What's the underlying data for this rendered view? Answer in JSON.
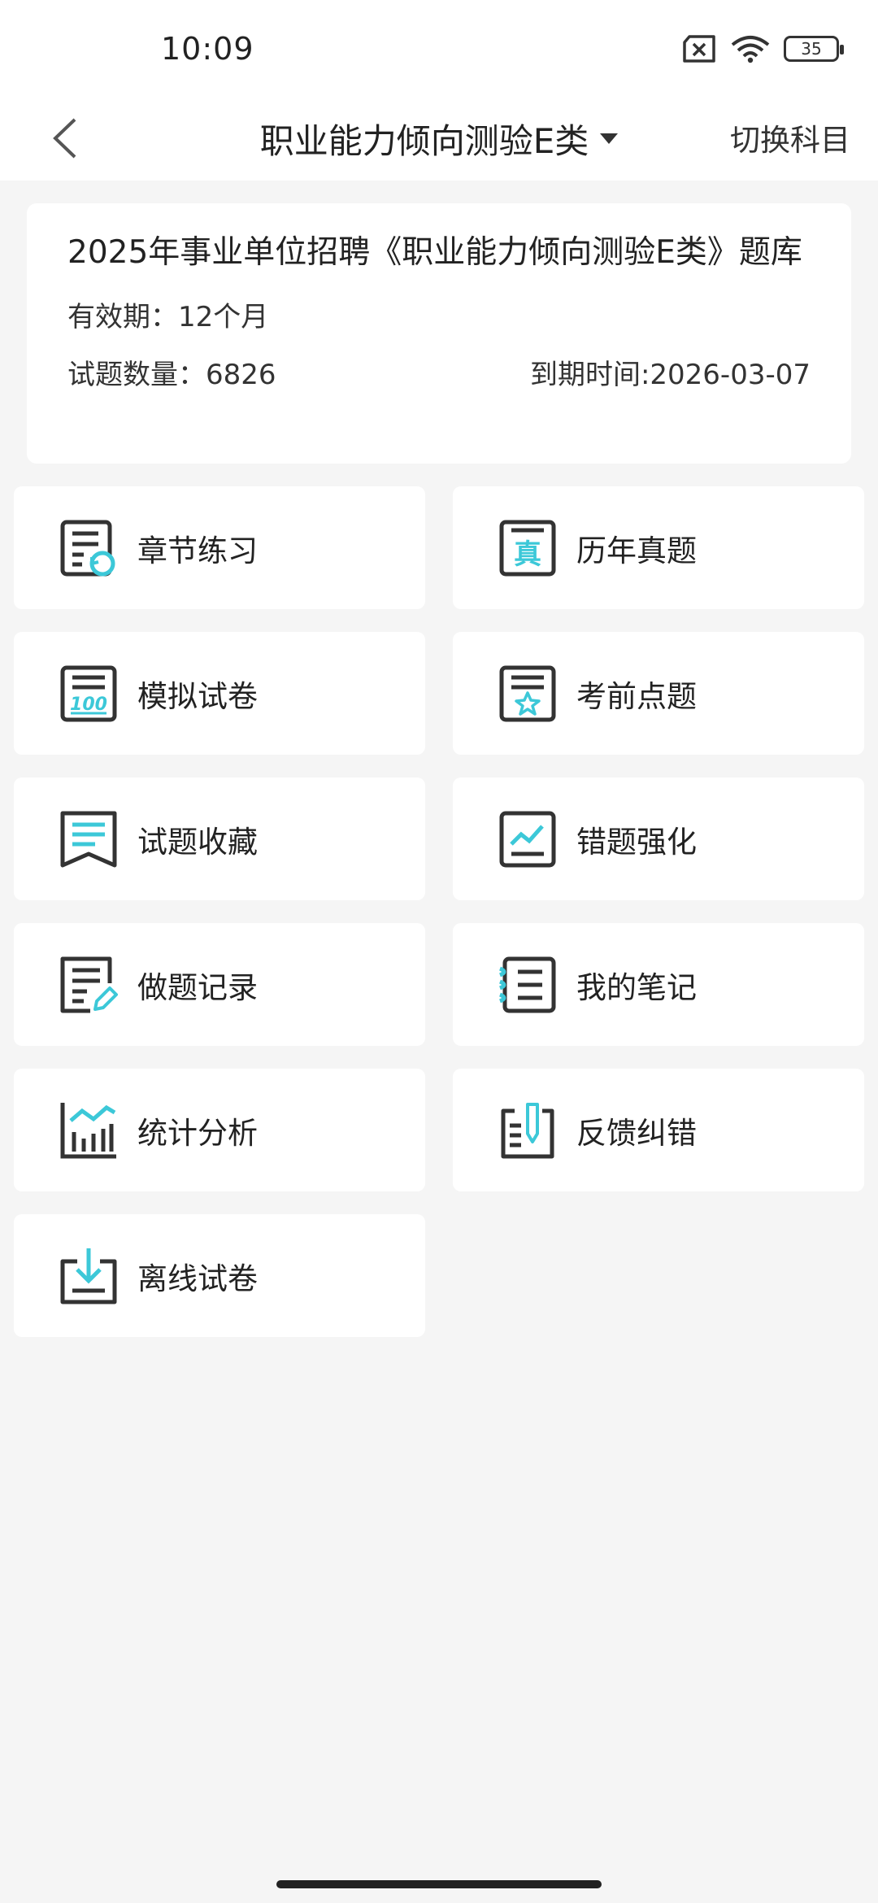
{
  "status_bar": {
    "time": "10:09",
    "battery": "35"
  },
  "header": {
    "title": "职业能力倾向测验E类",
    "switch_label": "切换科目"
  },
  "info": {
    "title": "2025年事业单位招聘《职业能力倾向测验E类》题库",
    "validity": "有效期：12个月",
    "count": "试题数量：6826",
    "expiry": "到期时间:2026-03-07"
  },
  "menu": [
    {
      "label": "章节练习",
      "icon": "chapter-practice-icon"
    },
    {
      "label": "历年真题",
      "icon": "past-papers-icon"
    },
    {
      "label": "模拟试卷",
      "icon": "mock-exam-icon"
    },
    {
      "label": "考前点题",
      "icon": "pre-exam-tips-icon"
    },
    {
      "label": "试题收藏",
      "icon": "bookmark-icon"
    },
    {
      "label": "错题强化",
      "icon": "mistake-review-icon"
    },
    {
      "label": "做题记录",
      "icon": "practice-record-icon"
    },
    {
      "label": "我的笔记",
      "icon": "notebook-icon"
    },
    {
      "label": "统计分析",
      "icon": "statistics-icon"
    },
    {
      "label": "反馈纠错",
      "icon": "feedback-icon"
    },
    {
      "label": "离线试卷",
      "icon": "download-icon"
    }
  ],
  "colors": {
    "accent": "#3cc8d8",
    "icon_dark": "#333333",
    "background": "#f5f5f5"
  }
}
